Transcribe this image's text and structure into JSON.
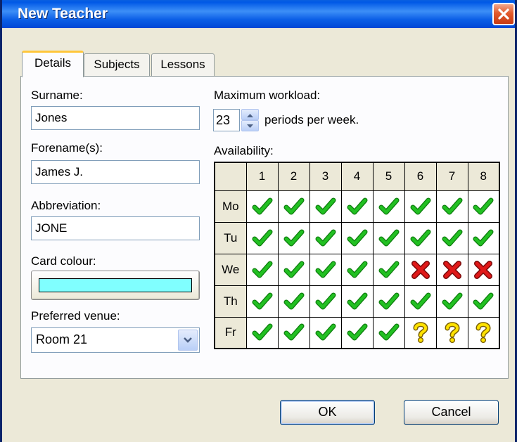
{
  "window": {
    "title": "New Teacher"
  },
  "tabs": [
    {
      "label": "Details",
      "active": true
    },
    {
      "label": "Subjects",
      "active": false
    },
    {
      "label": "Lessons",
      "active": false
    }
  ],
  "details": {
    "surname": {
      "label": "Surname:",
      "value": "Jones"
    },
    "forename": {
      "label": "Forename(s):",
      "value": "James J."
    },
    "abbreviation": {
      "label": "Abbreviation:",
      "value": "JONE"
    },
    "card_colour": {
      "label": "Card colour:",
      "color": "#80ffff"
    },
    "preferred_venue": {
      "label": "Preferred venue:",
      "value": "Room 21"
    },
    "max_workload": {
      "label": "Maximum workload:",
      "value": "23",
      "unit_text": "periods per week."
    },
    "availability": {
      "label": "Availability:",
      "periods": [
        "1",
        "2",
        "3",
        "4",
        "5",
        "6",
        "7",
        "8"
      ],
      "days": [
        {
          "day": "Mo",
          "slots": [
            "yes",
            "yes",
            "yes",
            "yes",
            "yes",
            "yes",
            "yes",
            "yes"
          ]
        },
        {
          "day": "Tu",
          "slots": [
            "yes",
            "yes",
            "yes",
            "yes",
            "yes",
            "yes",
            "yes",
            "yes"
          ]
        },
        {
          "day": "We",
          "slots": [
            "yes",
            "yes",
            "yes",
            "yes",
            "yes",
            "no",
            "no",
            "no"
          ]
        },
        {
          "day": "Th",
          "slots": [
            "yes",
            "yes",
            "yes",
            "yes",
            "yes",
            "yes",
            "yes",
            "yes"
          ]
        },
        {
          "day": "Fr",
          "slots": [
            "yes",
            "yes",
            "yes",
            "yes",
            "yes",
            "maybe",
            "maybe",
            "maybe"
          ]
        }
      ]
    }
  },
  "buttons": {
    "ok": "OK",
    "cancel": "Cancel"
  },
  "colors": {
    "titlebar": "#0058e6",
    "check": "#22c022",
    "cross": "#e01818",
    "question": "#ffe200",
    "card_swatch": "#80ffff"
  },
  "icons": {
    "yes": "check-icon",
    "no": "cross-icon",
    "maybe": "question-icon"
  }
}
